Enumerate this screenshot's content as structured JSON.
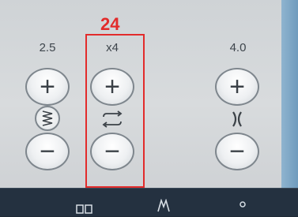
{
  "callout": {
    "number": "24"
  },
  "controls": [
    {
      "value": "2.5",
      "plus": "+",
      "minus": "−",
      "icon": "stitch-width-icon"
    },
    {
      "value": "x4",
      "plus": "+",
      "minus": "−",
      "icon": "repeat-icon"
    },
    {
      "value": "4.0",
      "plus": "+",
      "minus": "−",
      "icon": "stitch-length-icon"
    }
  ],
  "colors": {
    "accent_red": "#e22b2b",
    "panel": "#d4d7da",
    "side_strip": "#7fa9c8",
    "bottom_bar": "#243140"
  }
}
